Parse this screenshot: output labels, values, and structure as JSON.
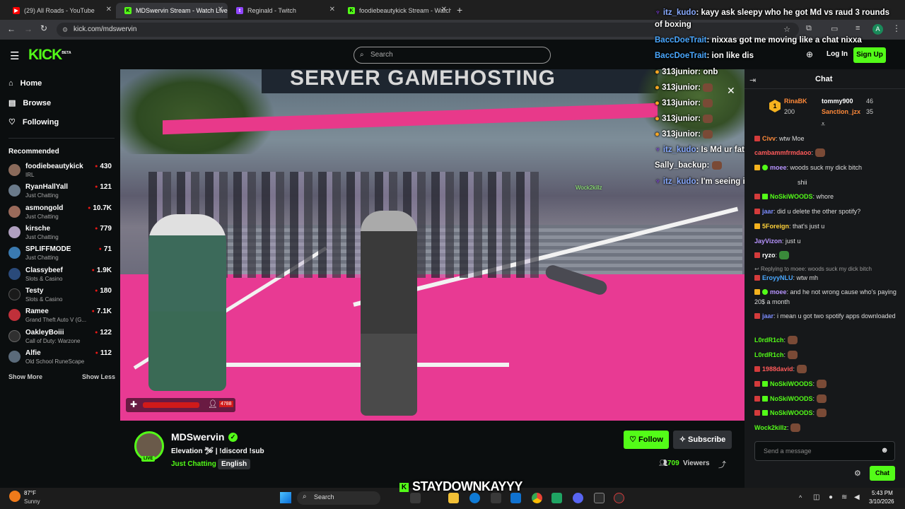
{
  "browser": {
    "tabs": [
      {
        "title": "(29) All Roads - YouTube",
        "fav": "youtube-icon",
        "color": "#ff0000"
      },
      {
        "title": "MDSwervin Stream - Watch Live",
        "fav": "kick-icon",
        "color": "#53fc18"
      },
      {
        "title": "Reginald - Twitch",
        "fav": "twitch-icon",
        "color": "#9146ff"
      },
      {
        "title": "foodiebeautykick Stream - Watch",
        "fav": "kick-icon",
        "color": "#53fc18"
      }
    ],
    "url": "kick.com/mdswervin",
    "new_tab": "+",
    "profile_initial": "A"
  },
  "header": {
    "logo": "KICK",
    "logo_beta": "BETA",
    "search_placeholder": "Search",
    "login": "Log In",
    "signup": "Sign Up"
  },
  "sidebar": {
    "nav": [
      {
        "label": "Home",
        "icon": "home-icon"
      },
      {
        "label": "Browse",
        "icon": "browse-icon"
      },
      {
        "label": "Following",
        "icon": "heart-icon"
      }
    ],
    "recommended_title": "Recommended",
    "recommended": [
      {
        "name": "foodiebeautykick",
        "category": "IRL",
        "viewers": "430",
        "color": "#8a6a5a"
      },
      {
        "name": "RyanHallYall",
        "category": "Just Chatting",
        "viewers": "121",
        "color": "#6a7a8a"
      },
      {
        "name": "asmongold",
        "category": "Just Chatting",
        "viewers": "10.7K",
        "color": "#9a6a5a"
      },
      {
        "name": "kirsche",
        "category": "Just Chatting",
        "viewers": "779",
        "color": "#b0a0c0"
      },
      {
        "name": "SPLIFFMODE",
        "category": "Just Chatting",
        "viewers": "71",
        "color": "#3a7ab0"
      },
      {
        "name": "Classybeef",
        "category": "Slots & Casino",
        "viewers": "1.9K",
        "color": "#2a4a7a"
      },
      {
        "name": "Testy",
        "category": "Slots & Casino",
        "viewers": "180",
        "color": "#1a1a1a"
      },
      {
        "name": "Ramee",
        "category": "Grand Theft Auto V (G...",
        "viewers": "7.1K",
        "color": "#c0303a"
      },
      {
        "name": "OakleyBoiii",
        "category": "Call of Duty: Warzone",
        "viewers": "122",
        "color": "#303030"
      },
      {
        "name": "Alfie",
        "category": "Old School RuneScape",
        "viewers": "112",
        "color": "#5a6a7a"
      }
    ],
    "show_more": "Show More",
    "show_less": "Show Less"
  },
  "video": {
    "banner_text": "SERVER GAMEHOSTING",
    "player_tag": "Wock2killz",
    "viewer_count_badge": "4788"
  },
  "overlay_chat": [
    {
      "user": "itz_kudo",
      "color": "#ffffff",
      "text": "kayy ask sleepy who he got Md vs raud 3 rounds"
    },
    {
      "user": "",
      "color": "#ffffff",
      "text": "of boxing"
    },
    {
      "user": "BaccDoeTrait",
      "color": "#4aa8ff",
      "text": "nixxas got me moving like a chat nixxa"
    },
    {
      "user": "BaccDoeTrait",
      "color": "#4aa8ff",
      "text": "ion like dis"
    },
    {
      "user": "313junior",
      "color": "#ffffff",
      "text": "onb"
    },
    {
      "user": "313junior",
      "color": "#ffffff",
      "text": ""
    },
    {
      "user": "313junior",
      "color": "#ffffff",
      "text": ""
    },
    {
      "user": "313junior",
      "color": "#ffffff",
      "text": ""
    },
    {
      "user": "313junior",
      "color": "#ffffff",
      "text": ""
    },
    {
      "user": "itz_kudo",
      "color": "#ffffff",
      "text": "Is Md ur father"
    },
    {
      "user": "Sally_backup",
      "color": "#ffffff",
      "text": ""
    },
    {
      "user": "itz_kudo",
      "color": "#ffffff",
      "text": "I'm seeing it u pussy kayy"
    }
  ],
  "stream_info": {
    "streamer": "MDSwervin",
    "live_badge": "LIVE",
    "title": "Elevation 🛩 | !discord !sub",
    "category": "Just Chatting",
    "language": "English",
    "follow": "Follow",
    "subscribe": "Subscribe",
    "viewers": "709",
    "viewers_label": "Viewers"
  },
  "chat": {
    "title": "Chat",
    "leaders": [
      {
        "rank": "1",
        "name": "RinaBK",
        "value": "200"
      },
      {
        "rank": "",
        "name": "tommy900",
        "value": "46"
      },
      {
        "rank": "",
        "name": "Sanction_jzx",
        "value": "35"
      }
    ],
    "messages": [
      {
        "user": "Civv",
        "color": "#ff8a3a",
        "text": "wtw Moe"
      },
      {
        "user": "cambammfrmdaoo",
        "color": "#ff5a5a",
        "text": ""
      },
      {
        "user": "moee",
        "color": "#b794ff",
        "text": "woods suck my dick bitch"
      },
      {
        "user": "",
        "color": "#ffffff",
        "text": "shii"
      },
      {
        "user": "NoSkiWOODS",
        "color": "#53fc18",
        "text": "whore"
      },
      {
        "user": "jaar",
        "color": "#7b8cff",
        "text": "did u delete the other spotify?"
      },
      {
        "user": "5Foreign",
        "color": "#ffd23a",
        "text": "that's just u"
      },
      {
        "user": "JayVizon",
        "color": "#b794ff",
        "text": "just u"
      },
      {
        "user": "ryzo",
        "color": "#ffffff",
        "text": ""
      },
      {
        "user": "",
        "color": "#9a9a9a",
        "text": "Replying to moee: woods suck my dick bitch"
      },
      {
        "user": "EroyyNLU",
        "color": "#4aa8ff",
        "text": "wtw mh"
      },
      {
        "user": "moee",
        "color": "#b794ff",
        "text": "and he not wrong cause who's paying 20$ a month"
      },
      {
        "user": "jaar",
        "color": "#7b8cff",
        "text": "i mean u got two spotify apps downloaded"
      },
      {
        "user": "L0rdR1ch",
        "color": "#53fc18",
        "text": ""
      },
      {
        "user": "L0rdR1ch",
        "color": "#53fc18",
        "text": ""
      },
      {
        "user": "1988david",
        "color": "#ff5a5a",
        "text": ""
      },
      {
        "user": "NoSkiWOODS",
        "color": "#53fc18",
        "text": ""
      },
      {
        "user": "NoSkiWOODS",
        "color": "#53fc18",
        "text": ""
      },
      {
        "user": "NoSkiWOODS",
        "color": "#53fc18",
        "text": ""
      },
      {
        "user": "Wock2killz",
        "color": "#53fc18",
        "text": ""
      }
    ],
    "input_placeholder": "Send a message",
    "send": "Chat"
  },
  "taskbar": {
    "weather_temp": "87°F",
    "weather_desc": "Sunny",
    "search": "Search",
    "overlay_name": "STAYDOWNKAYYY",
    "time": "5:43 PM",
    "date": "3/10/2026"
  },
  "colors": {
    "accent": "#53fc18",
    "bg": "#0b0e0f",
    "chat_bg": "#16181a",
    "live_red": "#e91916"
  }
}
